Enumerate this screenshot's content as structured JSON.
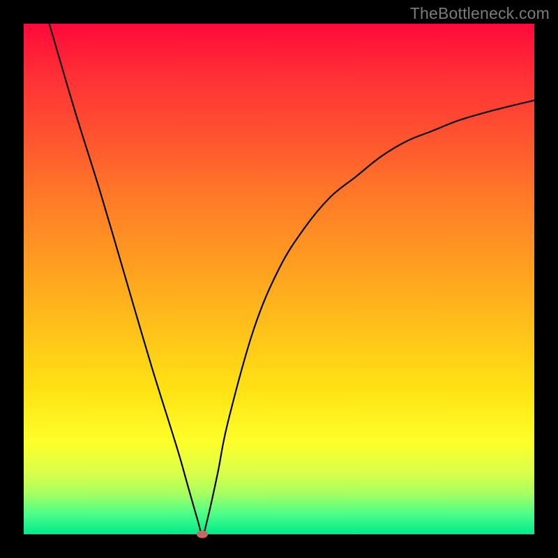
{
  "watermark": "TheBottleneck.com",
  "chart_data": {
    "type": "line",
    "title": "",
    "xlabel": "",
    "ylabel": "",
    "xlim": [
      0,
      100
    ],
    "ylim": [
      0,
      100
    ],
    "grid": false,
    "series": [
      {
        "name": "curve",
        "x": [
          5,
          10,
          15,
          20,
          25,
          30,
          32,
          34,
          35,
          36,
          38,
          40,
          45,
          50,
          55,
          60,
          65,
          70,
          75,
          80,
          85,
          90,
          95,
          100
        ],
        "y": [
          100,
          83,
          67,
          50,
          33,
          17,
          10,
          3,
          0,
          3,
          12,
          22,
          40,
          52,
          60,
          66,
          70,
          74,
          77,
          79,
          81,
          82.5,
          83.8,
          85
        ]
      }
    ],
    "min_point": {
      "x": 35,
      "y": 0
    },
    "colors": {
      "curve": "#000000",
      "min_point": "#cb6666",
      "gradient_top": "#ff0a3a",
      "gradient_bottom": "#00e98a"
    }
  }
}
